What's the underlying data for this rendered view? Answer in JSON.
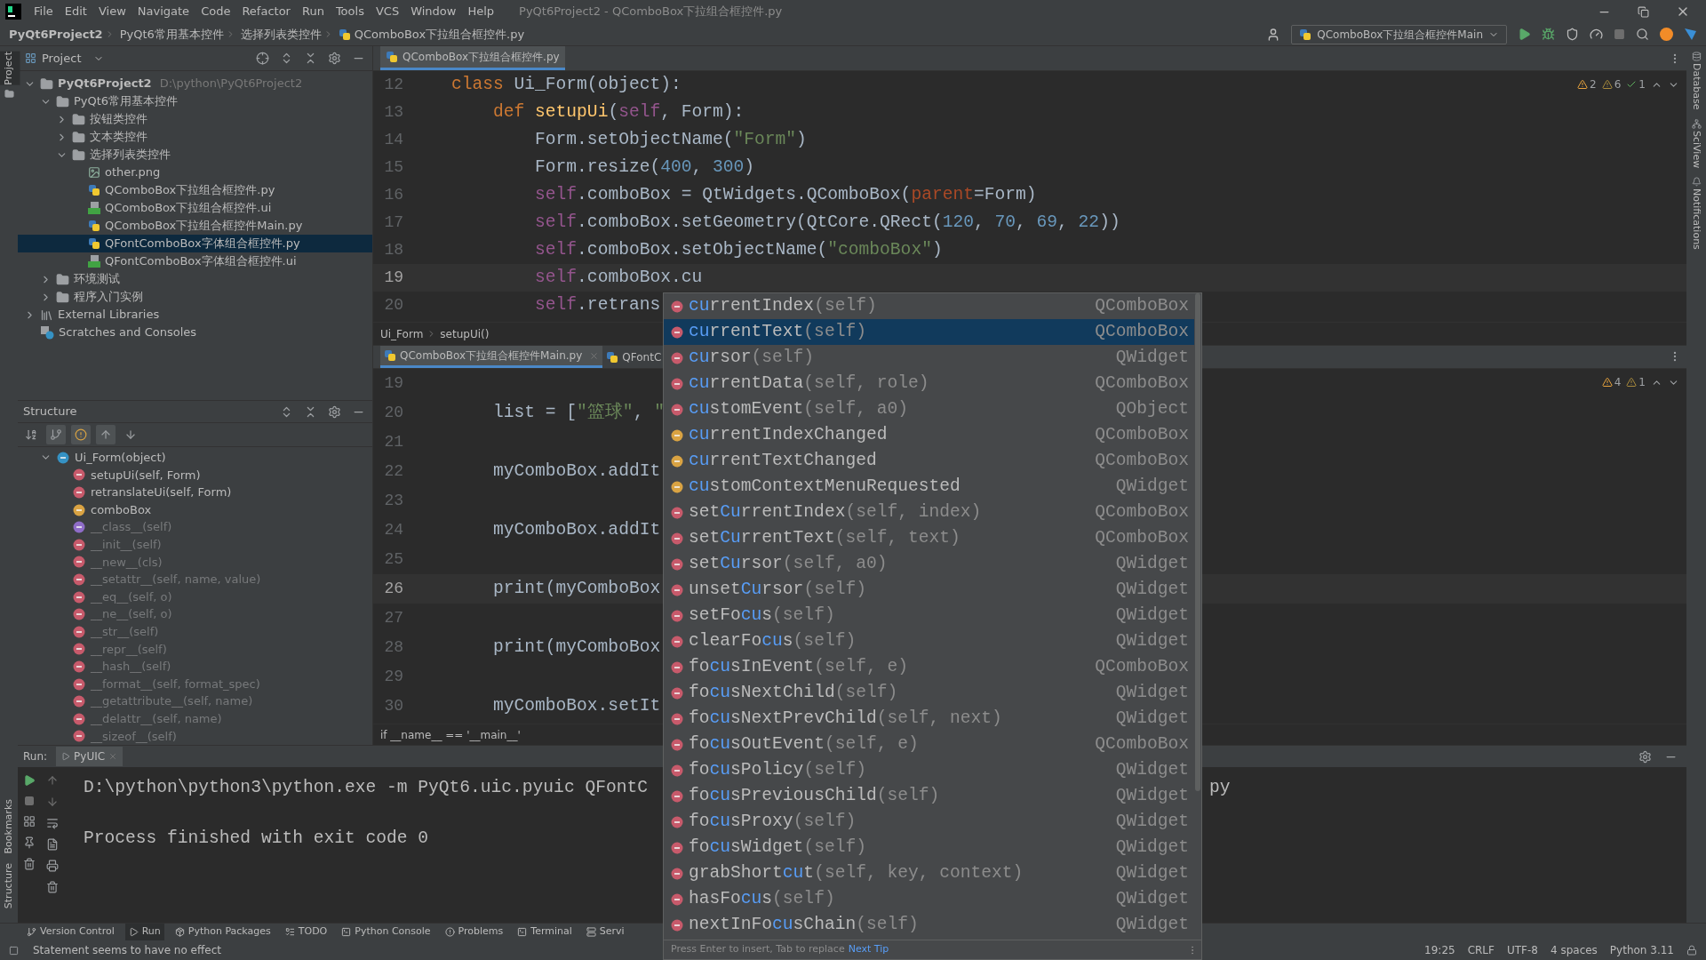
{
  "menu_bar": {
    "items": [
      "File",
      "Edit",
      "View",
      "Navigate",
      "Code",
      "Refactor",
      "Run",
      "Tools",
      "VCS",
      "Window",
      "Help"
    ],
    "title": "PyQt6Project2 - QComboBox下拉组合框控件.py"
  },
  "nav_bar": {
    "breadcrumbs": [
      "PyQt6Project2",
      "PyQt6常用基本控件",
      "选择列表类控件",
      "QComboBox下拉组合框控件.py"
    ],
    "run_config": "QComboBox下拉组合框控件Main"
  },
  "tool_strips": {
    "left": [
      {
        "label": "Project",
        "selected": true
      }
    ],
    "left_bottom": [
      {
        "label": "Bookmarks",
        "selected": false
      },
      {
        "label": "Structure",
        "selected": false
      }
    ],
    "right": [
      {
        "label": "Database",
        "selected": false
      },
      {
        "label": "SciView",
        "selected": false
      },
      {
        "label": "Notifications",
        "selected": false
      }
    ]
  },
  "project": {
    "title": "Project",
    "tree": [
      {
        "label": "PyQt6Project2",
        "path": "D:\\python\\PyQt6Project2",
        "kind": "project",
        "expanded": true,
        "selected": false,
        "children": [
          {
            "label": "PyQt6常用基本控件",
            "kind": "folder",
            "expanded": true,
            "selected": false,
            "children": [
              {
                "label": "按钮类控件",
                "kind": "folder",
                "expanded": false,
                "selected": false
              },
              {
                "label": "文本类控件",
                "kind": "folder",
                "expanded": false,
                "selected": false
              },
              {
                "label": "选择列表类控件",
                "kind": "folder",
                "expanded": true,
                "selected": false,
                "children": [
                  {
                    "label": "other.png",
                    "kind": "image",
                    "selected": false
                  },
                  {
                    "label": "QComboBox下拉组合框控件.py",
                    "kind": "python",
                    "selected": false
                  },
                  {
                    "label": "QComboBox下拉组合框控件.ui",
                    "kind": "ui",
                    "selected": false
                  },
                  {
                    "label": "QComboBox下拉组合框控件Main.py",
                    "kind": "python",
                    "selected": false
                  },
                  {
                    "label": "QFontComboBox字体组合框控件.py",
                    "kind": "python",
                    "selected": true
                  },
                  {
                    "label": "QFontComboBox字体组合框控件.ui",
                    "kind": "ui",
                    "selected": false
                  }
                ]
              }
            ]
          },
          {
            "label": "环境测试",
            "kind": "folder",
            "expanded": false,
            "selected": false
          },
          {
            "label": "程序入门实例",
            "kind": "folder",
            "expanded": false,
            "selected": false
          }
        ]
      },
      {
        "label": "External Libraries",
        "kind": "library",
        "expanded": false,
        "selected": false
      },
      {
        "label": "Scratches and Consoles",
        "kind": "scratches",
        "selected": false
      }
    ]
  },
  "structure": {
    "title": "Structure",
    "toolbar": [
      {
        "selected": false
      },
      {
        "selected": true
      },
      {
        "selected": true
      },
      {
        "selected": true
      },
      {
        "selected": false
      }
    ],
    "tree": [
      {
        "label": "Ui_Form(object)",
        "kind": "class",
        "inherited": false,
        "expanded": true,
        "children": [
          {
            "label": "setupUi(self, Form)",
            "kind": "method",
            "inherited": false
          },
          {
            "label": "retranslateUi(self, Form)",
            "kind": "method",
            "inherited": false
          },
          {
            "label": "comboBox",
            "kind": "field",
            "inherited": false
          },
          {
            "label": "__class__(self)",
            "kind": "property",
            "inherited": true
          },
          {
            "label": "__init__(self)",
            "kind": "method",
            "inherited": true
          },
          {
            "label": "__new__(cls)",
            "kind": "method",
            "inherited": true
          },
          {
            "label": "__setattr__(self, name, value)",
            "kind": "method",
            "inherited": true
          },
          {
            "label": "__eq__(self, o)",
            "kind": "method",
            "inherited": true
          },
          {
            "label": "__ne__(self, o)",
            "kind": "method",
            "inherited": true
          },
          {
            "label": "__str__(self)",
            "kind": "method",
            "inherited": true
          },
          {
            "label": "__repr__(self)",
            "kind": "method",
            "inherited": true
          },
          {
            "label": "__hash__(self)",
            "kind": "method",
            "inherited": true
          },
          {
            "label": "__format__(self, format_spec)",
            "kind": "method",
            "inherited": true
          },
          {
            "label": "__getattribute__(self, name)",
            "kind": "method",
            "inherited": true
          },
          {
            "label": "__delattr__(self, name)",
            "kind": "method",
            "inherited": true
          },
          {
            "label": "__sizeof__(self)",
            "kind": "method",
            "inherited": true
          }
        ]
      }
    ]
  },
  "editor_top": {
    "tabs": [
      {
        "label": "QComboBox下拉组合框控件.py",
        "selected": true
      }
    ],
    "inspections": [
      {
        "kind": "warning",
        "count": "2"
      },
      {
        "kind": "weak",
        "count": "6"
      },
      {
        "kind": "ok",
        "count": "1"
      }
    ],
    "lines": [
      {
        "no": "12",
        "current": false,
        "tokens": [
          {
            "kind": "keyword",
            "text": "class "
          },
          {
            "kind": "plain",
            "text": "Ui_Form(object):"
          }
        ]
      },
      {
        "no": "13",
        "current": false,
        "tokens": [
          {
            "kind": "keyword",
            "text": "    def "
          },
          {
            "kind": "function",
            "text": "setupUi"
          },
          {
            "kind": "plain",
            "text": "("
          },
          {
            "kind": "self",
            "text": "self"
          },
          {
            "kind": "plain",
            "text": ", Form):"
          }
        ]
      },
      {
        "no": "14",
        "current": false,
        "tokens": [
          {
            "kind": "plain",
            "text": "        Form.setObjectName("
          },
          {
            "kind": "string",
            "text": "\"Form\""
          },
          {
            "kind": "plain",
            "text": ")"
          }
        ]
      },
      {
        "no": "15",
        "current": false,
        "tokens": [
          {
            "kind": "plain",
            "text": "        Form.resize("
          },
          {
            "kind": "number",
            "text": "400"
          },
          {
            "kind": "plain",
            "text": ", "
          },
          {
            "kind": "number",
            "text": "300"
          },
          {
            "kind": "plain",
            "text": ")"
          }
        ]
      },
      {
        "no": "16",
        "current": false,
        "tokens": [
          {
            "kind": "self",
            "text": "        self"
          },
          {
            "kind": "plain",
            "text": ".comboBox = QtWidgets.QComboBox("
          },
          {
            "kind": "param",
            "text": "parent"
          },
          {
            "kind": "plain",
            "text": "=Form)"
          }
        ]
      },
      {
        "no": "17",
        "current": false,
        "tokens": [
          {
            "kind": "self",
            "text": "        self"
          },
          {
            "kind": "plain",
            "text": ".comboBox.setGeometry(QtCore.QRect("
          },
          {
            "kind": "number",
            "text": "120"
          },
          {
            "kind": "plain",
            "text": ", "
          },
          {
            "kind": "number",
            "text": "70"
          },
          {
            "kind": "plain",
            "text": ", "
          },
          {
            "kind": "number",
            "text": "69"
          },
          {
            "kind": "plain",
            "text": ", "
          },
          {
            "kind": "number",
            "text": "22"
          },
          {
            "kind": "plain",
            "text": "))"
          }
        ]
      },
      {
        "no": "18",
        "current": false,
        "tokens": [
          {
            "kind": "self",
            "text": "        self"
          },
          {
            "kind": "plain",
            "text": ".comboBox.setObjectName("
          },
          {
            "kind": "string",
            "text": "\"comboBox\""
          },
          {
            "kind": "plain",
            "text": ")"
          }
        ]
      },
      {
        "no": "19",
        "current": true,
        "tokens": [
          {
            "kind": "self",
            "text": "        self"
          },
          {
            "kind": "plain",
            "text": ".comboBox.cu"
          }
        ]
      },
      {
        "no": "20",
        "current": false,
        "tokens": [
          {
            "kind": "self",
            "text": "        self"
          },
          {
            "kind": "plain",
            "text": ".retrans"
          }
        ]
      }
    ],
    "breadcrumbs": [
      "Ui_Form",
      "setupUi()"
    ]
  },
  "editor_bottom": {
    "tabs": [
      {
        "label": "QComboBox下拉组合框控件Main.py",
        "selected": true
      },
      {
        "label": "QFontC",
        "selected": false
      }
    ],
    "inspections": [
      {
        "kind": "warning",
        "count": "4"
      },
      {
        "kind": "weak",
        "count": "1"
      }
    ],
    "lines": [
      {
        "no": "19",
        "current": false
      },
      {
        "no": "20",
        "current": false,
        "tokens": [
          {
            "kind": "plain",
            "text": "    list = ["
          },
          {
            "kind": "string",
            "text": "\"篮球\""
          },
          {
            "kind": "plain",
            "text": ", "
          },
          {
            "kind": "string",
            "text": "\""
          }
        ]
      },
      {
        "no": "21",
        "current": false
      },
      {
        "no": "22",
        "current": false,
        "tokens": [
          {
            "kind": "plain",
            "text": "    myComboBox.addIt"
          }
        ]
      },
      {
        "no": "23",
        "current": false
      },
      {
        "no": "24",
        "current": false,
        "tokens": [
          {
            "kind": "plain",
            "text": "    myComboBox.addIt"
          }
        ]
      },
      {
        "no": "25",
        "current": false
      },
      {
        "no": "26",
        "current": true,
        "tokens": [
          {
            "kind": "plain",
            "text": "    print(myComboBox"
          }
        ]
      },
      {
        "no": "27",
        "current": false
      },
      {
        "no": "28",
        "current": false,
        "tokens": [
          {
            "kind": "plain",
            "text": "    print(myComboBox"
          }
        ]
      },
      {
        "no": "29",
        "current": false
      },
      {
        "no": "30",
        "current": false,
        "tokens": [
          {
            "kind": "plain",
            "text": "    myComboBox.setIt"
          }
        ]
      }
    ],
    "breadcrumbs": [
      "if __name__ == '__main__'"
    ]
  },
  "run": {
    "title": "Run:",
    "tab": "PyUIC",
    "output": [
      "D:\\python\\python3\\python.exe -m PyQt6.uic.pyuic QFontC",
      "py",
      "Process finished with exit code 0"
    ]
  },
  "tool_tabs": [
    {
      "label": "Version Control",
      "selected": false
    },
    {
      "label": "Run",
      "selected": true
    },
    {
      "label": "Python Packages",
      "selected": false
    },
    {
      "label": "TODO",
      "selected": false
    },
    {
      "label": "Python Console",
      "selected": false
    },
    {
      "label": "Problems",
      "selected": false
    },
    {
      "label": "Terminal",
      "selected": false
    },
    {
      "label": "Servi",
      "selected": false
    }
  ],
  "status_bar": {
    "message": "Statement seems to have no effect",
    "items": [
      "19:25",
      "CRLF",
      "UTF-8",
      "4 spaces",
      "Python 3.11"
    ]
  },
  "completion": {
    "footer": "Press Enter to insert, Tab to replace",
    "footer_link": "Next Tip",
    "items": [
      {
        "match": "cu",
        "rest": "rrentIndex",
        "params": "(self)",
        "type": "QComboBox",
        "kind": "method",
        "selected": false
      },
      {
        "match": "cu",
        "rest": "rrentText",
        "params": "(self)",
        "type": "QComboBox",
        "kind": "method",
        "selected": true
      },
      {
        "match": "cu",
        "rest": "rsor",
        "params": "(self)",
        "type": "QWidget",
        "kind": "method",
        "selected": false
      },
      {
        "match": "cu",
        "rest": "rrentData",
        "params": "(self, role)",
        "type": "QComboBox",
        "kind": "method",
        "selected": false
      },
      {
        "match": "cu",
        "rest": "stomEvent",
        "params": "(self, a0)",
        "type": "QObject",
        "kind": "method",
        "selected": false
      },
      {
        "match": "cu",
        "rest": "rrentIndexChanged",
        "type": "QComboBox",
        "kind": "field",
        "selected": false
      },
      {
        "match": "cu",
        "rest": "rrentTextChanged",
        "type": "QComboBox",
        "kind": "field",
        "selected": false
      },
      {
        "match": "cu",
        "rest": "stomContextMenuRequested",
        "type": "QWidget",
        "kind": "field",
        "selected": false
      },
      {
        "pre": "set",
        "match": "Cu",
        "rest": "rrentIndex",
        "params": "(self, index)",
        "type": "QComboBox",
        "kind": "method",
        "selected": false
      },
      {
        "pre": "set",
        "match": "Cu",
        "rest": "rrentText",
        "params": "(self, text)",
        "type": "QComboBox",
        "kind": "method",
        "selected": false
      },
      {
        "pre": "set",
        "match": "Cu",
        "rest": "rsor",
        "params": "(self, a0)",
        "type": "QWidget",
        "kind": "method",
        "selected": false
      },
      {
        "pre": "unset",
        "match": "Cu",
        "rest": "rsor",
        "params": "(self)",
        "type": "QWidget",
        "kind": "method",
        "selected": false
      },
      {
        "pre": "setFo",
        "match": "cu",
        "rest": "s",
        "params": "(self)",
        "type": "QWidget",
        "kind": "method",
        "selected": false
      },
      {
        "pre": "clearFo",
        "match": "cu",
        "rest": "s",
        "params": "(self)",
        "type": "QWidget",
        "kind": "method",
        "selected": false
      },
      {
        "pre": "fo",
        "match": "cu",
        "rest": "sInEvent",
        "params": "(self, e)",
        "type": "QComboBox",
        "kind": "method",
        "selected": false
      },
      {
        "pre": "fo",
        "match": "cu",
        "rest": "sNextChild",
        "params": "(self)",
        "type": "QWidget",
        "kind": "method",
        "selected": false
      },
      {
        "pre": "fo",
        "match": "cu",
        "rest": "sNextPrevChild",
        "params": "(self, next)",
        "type": "QWidget",
        "kind": "method",
        "selected": false
      },
      {
        "pre": "fo",
        "match": "cu",
        "rest": "sOutEvent",
        "params": "(self, e)",
        "type": "QComboBox",
        "kind": "method",
        "selected": false
      },
      {
        "pre": "fo",
        "match": "cu",
        "rest": "sPolicy",
        "params": "(self)",
        "type": "QWidget",
        "kind": "method",
        "selected": false
      },
      {
        "pre": "fo",
        "match": "cu",
        "rest": "sPreviousChild",
        "params": "(self)",
        "type": "QWidget",
        "kind": "method",
        "selected": false
      },
      {
        "pre": "fo",
        "match": "cu",
        "rest": "sProxy",
        "params": "(self)",
        "type": "QWidget",
        "kind": "method",
        "selected": false
      },
      {
        "pre": "fo",
        "match": "cu",
        "rest": "sWidget",
        "params": "(self)",
        "type": "QWidget",
        "kind": "method",
        "selected": false
      },
      {
        "pre": "grabShort",
        "match": "cu",
        "rest": "t",
        "params": "(self, key, context)",
        "type": "QWidget",
        "kind": "method",
        "selected": false
      },
      {
        "pre": "hasFo",
        "match": "cu",
        "rest": "s",
        "params": "(self)",
        "type": "QWidget",
        "kind": "method",
        "selected": false
      },
      {
        "pre": "nextInFo",
        "match": "cu",
        "rest": "sChain",
        "params": "(self)",
        "type": "QWidget",
        "kind": "method",
        "selected": false
      }
    ]
  }
}
